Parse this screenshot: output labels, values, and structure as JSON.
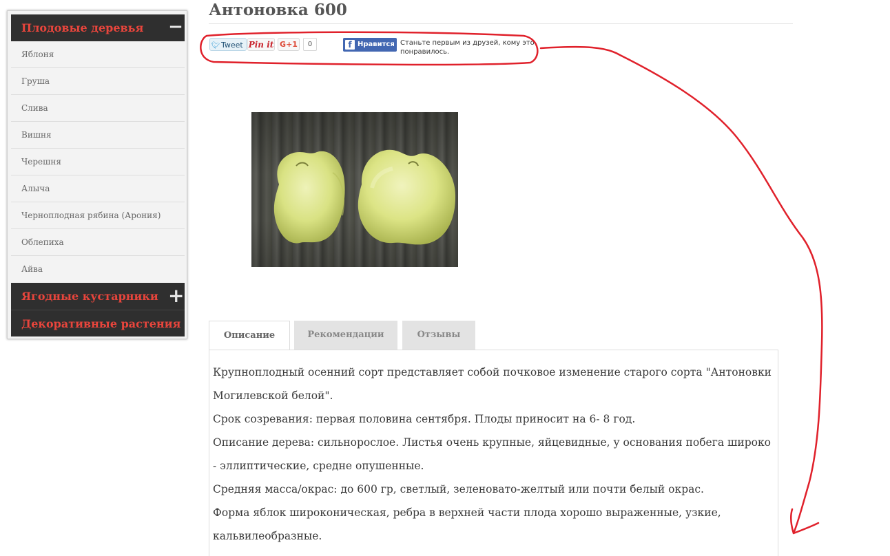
{
  "sidebar": {
    "categories": [
      {
        "label": "Плодовые деревья",
        "toggle": "−"
      },
      {
        "label": "Ягодные кустарники",
        "toggle": "+"
      },
      {
        "label": "Декоративные растения"
      }
    ],
    "items": [
      "Яблоня",
      "Груша",
      "Слива",
      "Вишня",
      "Черешня",
      "Алыча",
      "Черноплодная рябина (Арония)",
      "Облепиха",
      "Айва"
    ]
  },
  "product": {
    "title": "Антоновка 600"
  },
  "share": {
    "tweet": "Tweet",
    "pin": "Pin it",
    "gplus": "G+1",
    "gplus_count": "0",
    "fb_like": "Нравится",
    "fb_text": "Станьте первым из друзей, кому это понравилось."
  },
  "tabs": [
    "Описание",
    "Рекомендации",
    "Отзывы"
  ],
  "description": {
    "lines": [
      " Крупноплодный осенний сорт представляет собой почковое изменение старого сорта \"Антоновки Могилевской белой\".",
      "Срок созревания: первая половина сентября. Плоды приносит на 6- 8 год.",
      "Описание дерева: сильнорослое. Листья очень крупные, яйцевидные, у основания побега широко - эллиптические, средне опушенные.",
      "Средняя масса/окрас: до 600 гр, светлый, зеленовато-желтый или почти белый окрас.",
      "Форма яблок широконическая, ребра в верхней части плода хорошо выраженные, узкие, кальвилеобразные."
    ]
  },
  "colors": {
    "category_text": "#e8453c",
    "category_bg": "#2f2f2f",
    "annotation": "#e0212b"
  }
}
